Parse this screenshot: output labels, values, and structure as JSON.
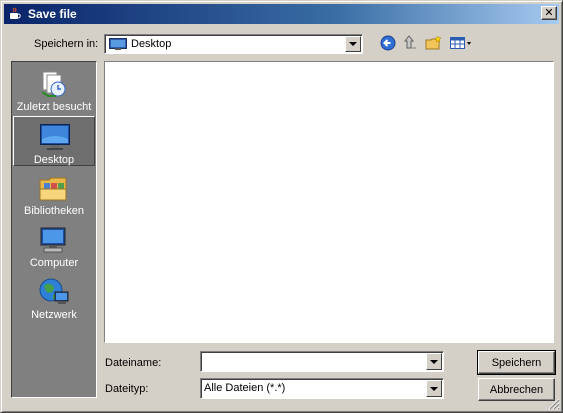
{
  "window": {
    "title": "Save file",
    "close_glyph": "✕"
  },
  "toolbar": {
    "look_in_label": "Speichern in:",
    "look_in_value": "Desktop",
    "icons": [
      "back-icon",
      "up-folder-icon",
      "new-folder-icon",
      "view-menu-icon"
    ]
  },
  "places": [
    {
      "label": "Zuletzt besucht",
      "icon": "recent-icon",
      "selected": false
    },
    {
      "label": "Desktop",
      "icon": "desktop-icon",
      "selected": true
    },
    {
      "label": "Bibliotheken",
      "icon": "libraries-icon",
      "selected": false
    },
    {
      "label": "Computer",
      "icon": "computer-icon",
      "selected": false
    },
    {
      "label": "Netzwerk",
      "icon": "network-icon",
      "selected": false
    }
  ],
  "filename": {
    "label": "Dateiname:",
    "value": ""
  },
  "filetype": {
    "label": "Dateityp:",
    "value": "Alle Dateien (*.*)"
  },
  "buttons": {
    "save": "Speichern",
    "cancel": "Abbrechen"
  },
  "colors": {
    "titlebar_start": "#0a246a",
    "face": "#d4d0c8",
    "places_bg": "#808080"
  }
}
